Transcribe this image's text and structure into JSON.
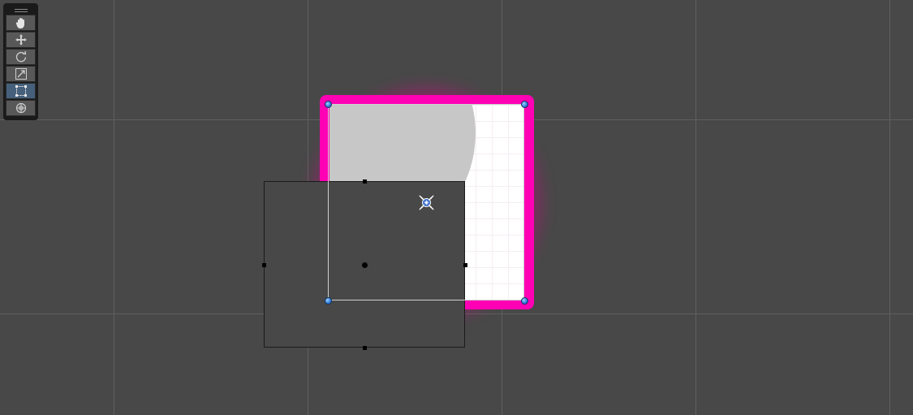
{
  "scene": {
    "accent": "#ff00b4",
    "active_tool_color": "#46607c",
    "handle_color": "#2f7ce0"
  },
  "toolbar": {
    "tools": [
      {
        "name": "hand-tool",
        "icon": "hand-icon",
        "active": false
      },
      {
        "name": "move-tool",
        "icon": "move-icon",
        "active": false
      },
      {
        "name": "rotate-tool",
        "icon": "rotate-icon",
        "active": false
      },
      {
        "name": "scale-tool",
        "icon": "scale-icon",
        "active": false
      },
      {
        "name": "rect-tool",
        "icon": "rect-transform-icon",
        "active": true
      },
      {
        "name": "transform-tool",
        "icon": "transform-icon",
        "active": false
      }
    ]
  }
}
